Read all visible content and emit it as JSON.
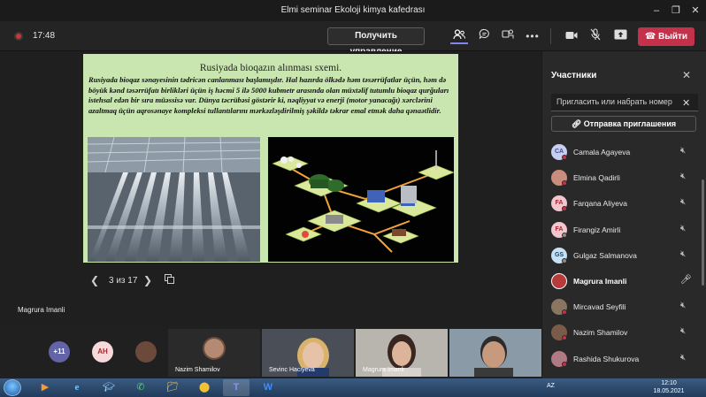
{
  "window": {
    "title": "Elmi seminar Ekoloji kimya kafedrası"
  },
  "toolbar": {
    "timer": "17:48",
    "control_label": "Получить управление",
    "leave_label": "Выйти"
  },
  "slide": {
    "title": "Rusiyada bioqazın alınması sxemi.",
    "body": "Rusiyada bioqaz sənayesinin tədricən canlanması başlamışdır. Hal hazırda ölkədə həm təsərrüfatlar üçün, həm də böyük kənd təsərrüfatı birlikləri üçün iş həcmi 5 ilə 5000 kubmetr arasında olan müxtəlif tutumlu bioqaz qurğuları istehsal edən bir sıra müəssisə var. Dünya təcrübəsi göstərir ki, nəqliyyat və enerji (motor yanacağı) xərclərini azaltmaq üçün aqrosənaye kompleksi tullantılarını mərkəzləşdirilmiş şəkildə təkrar emal etmək daha qənaətlidir.",
    "page_indicator": "3 из 17",
    "presenter": "Magrura Imanli"
  },
  "participants": {
    "title": "Участники",
    "invite_placeholder": "Пригласить или набрать номер",
    "share_label": "Отправка приглашения",
    "list": [
      {
        "name": "Camala Agayeva",
        "initials": "CA",
        "avatar_color": "#c5d0ef",
        "text_color": "#444791"
      },
      {
        "name": "Elmina Qadirli",
        "initials": "",
        "avatar_color": "#c98d7d",
        "text_color": "#ffffff"
      },
      {
        "name": "Farqana Aliyeva",
        "initials": "FA",
        "avatar_color": "#f1c6cf",
        "text_color": "#a4262c"
      },
      {
        "name": "Firangiz Amirli",
        "initials": "FA",
        "avatar_color": "#f1c6cf",
        "text_color": "#a4262c"
      },
      {
        "name": "Gulgaz Salmanova",
        "initials": "GS",
        "avatar_color": "#c7e0f4",
        "text_color": "#004e8c"
      },
      {
        "name": "Magrura Imanli",
        "initials": "",
        "avatar_color": "#b83b3b",
        "text_color": "#ffffff"
      },
      {
        "name": "Mircavad Seyfili",
        "initials": "",
        "avatar_color": "#8a7560",
        "text_color": "#ffffff"
      },
      {
        "name": "Nazim Shamilov",
        "initials": "",
        "avatar_color": "#7a5b4a",
        "text_color": "#ffffff"
      },
      {
        "name": "Rashida Shukurova",
        "initials": "",
        "avatar_color": "#b07a84",
        "text_color": "#ffffff"
      }
    ]
  },
  "strip": {
    "more_count": "+11",
    "ah_initials": "AH",
    "tiles": [
      {
        "name": "Nazim Shamilov"
      },
      {
        "name": "Sevinc Haciyeva"
      },
      {
        "name": "Magrura Imanli"
      },
      {
        "name": ""
      }
    ]
  },
  "taskbar": {
    "lang": "AZ",
    "time": "12:10",
    "date": "18.05.2021"
  }
}
